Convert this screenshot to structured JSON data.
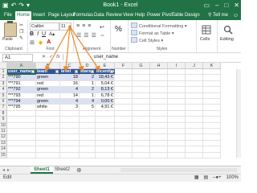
{
  "window": {
    "title": "Book1 - Excel",
    "qat_icons": [
      "save-icon",
      "undo-icon",
      "redo-icon",
      "customize-icon"
    ],
    "controls": [
      "ribbon-display-icon",
      "minimize-icon",
      "maximize-icon",
      "close-icon"
    ],
    "accent": "#217346"
  },
  "ribbon_tabs": [
    "File",
    "Home",
    "Insert",
    "Page Layout",
    "Formulas",
    "Data",
    "Review",
    "View",
    "Help",
    "Power Pivot",
    "Table Design"
  ],
  "tell_me": "Tell me",
  "ribbon": {
    "clipboard": {
      "paste": "Paste",
      "group": "Clipboard"
    },
    "font": {
      "name": "Calibri",
      "size": "11",
      "bold": "B",
      "italic": "I",
      "underline": "U",
      "group": "Font"
    },
    "alignment": {
      "group": "Alignment"
    },
    "number": {
      "percent": "%",
      "group": "Number"
    },
    "styles": {
      "conditional": "Conditional Formatting",
      "table": "Format as Table",
      "cell": "Cell Styles",
      "group": "Styles"
    },
    "cells": {
      "label": "Cells"
    },
    "editing": {
      "label": "Editing"
    }
  },
  "formula_bar": {
    "name_box": "A1",
    "cancel": "✕",
    "enter": "✓",
    "fx": "fx",
    "value": "user_name"
  },
  "columns": [
    "A",
    "B",
    "C",
    "D",
    "E",
    "F",
    "G",
    "H",
    "I",
    "J",
    "K"
  ],
  "rows": [
    "1",
    "2",
    "3",
    "4",
    "5",
    "6",
    "7",
    "8",
    "9",
    "10",
    "11",
    "12",
    "13",
    "14",
    "15"
  ],
  "table": {
    "headers": [
      "user_name",
      "team",
      "level",
      "stars",
      "incentive"
    ],
    "rows": [
      [
        "***790",
        "green",
        "18",
        "2",
        "18,43 €"
      ],
      [
        "***791",
        "red",
        "16",
        "1",
        "5,04 €"
      ],
      [
        "***792",
        "green",
        "4",
        "2",
        "8,13 €"
      ],
      [
        "***793",
        "red",
        "14",
        "1",
        "6,78 €"
      ],
      [
        "***794",
        "green",
        "4",
        "4",
        "0,00 €"
      ],
      [
        "***795",
        "white",
        "3",
        "5",
        "4,91 €"
      ]
    ]
  },
  "sheets": [
    "Sheet1",
    "Sheet2"
  ],
  "status": {
    "mode": "Edit",
    "zoom": "100%"
  }
}
